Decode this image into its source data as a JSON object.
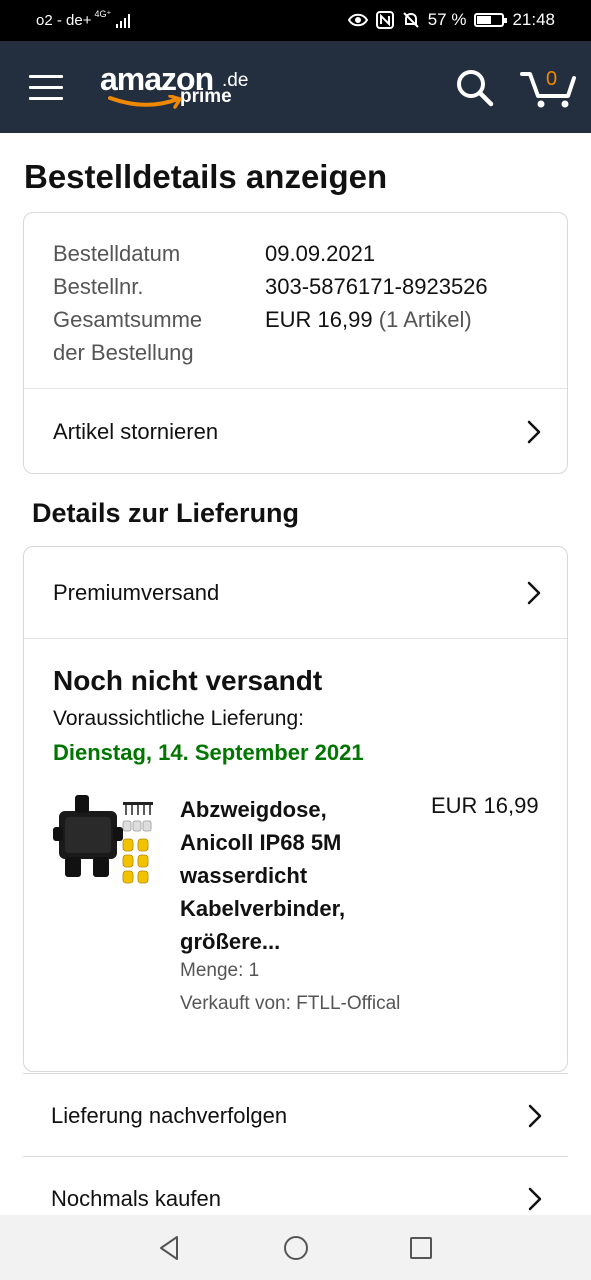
{
  "status_bar": {
    "carrier": "o2 - de+",
    "network": "4G⁺",
    "battery_percent": "57 %",
    "battery_level": 0.57,
    "time": "21:48"
  },
  "header": {
    "logo_word": "amazon",
    "logo_tld": ".de",
    "logo_sub": "prime",
    "cart_count": "0",
    "accent_color": "#f08804",
    "bg_color": "#232f3e"
  },
  "page": {
    "title": "Bestelldetails anzeigen"
  },
  "order_info": {
    "date_label": "Bestelldatum",
    "date_value": "09.09.2021",
    "number_label": "Bestellnr.",
    "number_value": "303-5876171-8923526",
    "total_label_1": "Gesamtsumme",
    "total_label_2": "der Bestellung",
    "total_value": "EUR 16,99",
    "total_items": "(1 Artikel)",
    "cancel_label": "Artikel stornieren"
  },
  "delivery": {
    "section_title": "Details zur Lieferung",
    "shipping_method": "Premiumversand",
    "status": "Noch nicht versandt",
    "eta_label": "Voraussichtliche Lieferung:",
    "eta_date": "Dienstag, 14. September 2021",
    "eta_color": "#007600"
  },
  "product": {
    "title_lines": [
      "Abzweigdose,",
      "Anicoll IP68 5M",
      "wasserdicht",
      "Kabelverbinder,",
      "größere..."
    ],
    "price": "EUR 16,99",
    "quantity": "Menge: 1",
    "seller": "Verkauft von: FTLL-Offical"
  },
  "actions": {
    "track": "Lieferung nachverfolgen",
    "buy_again": "Nochmals kaufen"
  }
}
